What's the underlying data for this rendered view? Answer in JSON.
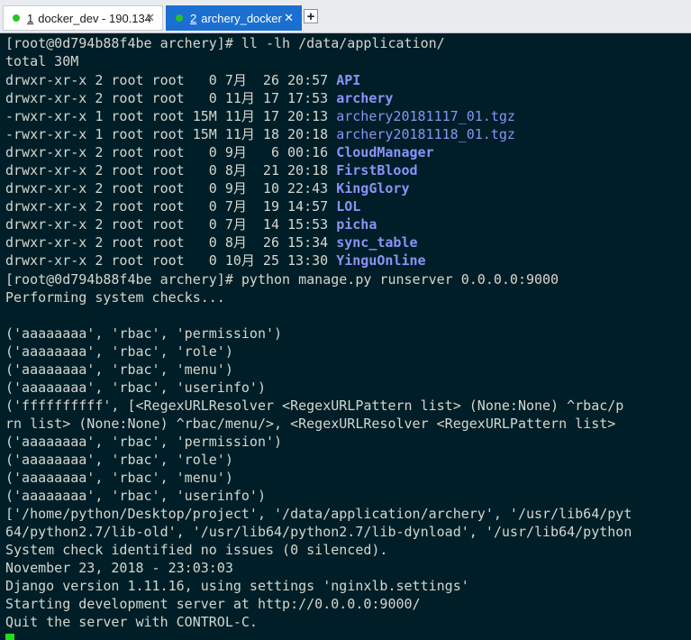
{
  "tabs": [
    {
      "num": "1",
      "label": "docker_dev - 190.134",
      "close": "✕"
    },
    {
      "num": "2",
      "label": "archery_docker",
      "close": "✕"
    }
  ],
  "add_tab_label": "+",
  "terminal": {
    "command1": "[root@0d794b88f4be archery]# ll -lh /data/application/",
    "total": "total 30M",
    "listing": [
      {
        "meta": "drwxr-xr-x 2 root root   0 7月  26 20:57 ",
        "name": "API"
      },
      {
        "meta": "drwxr-xr-x 2 root root   0 11月 17 17:53 ",
        "name": "archery"
      },
      {
        "meta": "-rwxr-xr-x 1 root root 15M 11月 17 20:13 ",
        "name": "archery20181117_01.tgz"
      },
      {
        "meta": "-rwxr-xr-x 1 root root 15M 11月 18 20:18 ",
        "name": "archery20181118_01.tgz"
      },
      {
        "meta": "drwxr-xr-x 2 root root   0 9月   6 00:16 ",
        "name": "CloudManager"
      },
      {
        "meta": "drwxr-xr-x 2 root root   0 8月  21 20:18 ",
        "name": "FirstBlood"
      },
      {
        "meta": "drwxr-xr-x 2 root root   0 9月  10 22:43 ",
        "name": "KingGlory"
      },
      {
        "meta": "drwxr-xr-x 2 root root   0 7月  19 14:57 ",
        "name": "LOL"
      },
      {
        "meta": "drwxr-xr-x 2 root root   0 7月  14 15:53 ",
        "name": "picha"
      },
      {
        "meta": "drwxr-xr-x 2 root root   0 8月  26 15:34 ",
        "name": "sync_table"
      },
      {
        "meta": "drwxr-xr-x 2 root root   0 10月 25 13:30 ",
        "name": "YinguOnline"
      }
    ],
    "output": [
      "[root@0d794b88f4be archery]# python manage.py runserver 0.0.0.0:9000",
      "Performing system checks...",
      "",
      "('aaaaaaaa', 'rbac', 'permission')",
      "('aaaaaaaa', 'rbac', 'role')",
      "('aaaaaaaa', 'rbac', 'menu')",
      "('aaaaaaaa', 'rbac', 'userinfo')",
      "('ffffffffff', [<RegexURLResolver <RegexURLPattern list> (None:None) ^rbac/p",
      "rn list> (None:None) ^rbac/menu/>, <RegexURLResolver <RegexURLPattern list> ",
      "('aaaaaaaa', 'rbac', 'permission')",
      "('aaaaaaaa', 'rbac', 'role')",
      "('aaaaaaaa', 'rbac', 'menu')",
      "('aaaaaaaa', 'rbac', 'userinfo')",
      "['/home/python/Desktop/project', '/data/application/archery', '/usr/lib64/pyt",
      "64/python2.7/lib-old', '/usr/lib64/python2.7/lib-dynload', '/usr/lib64/python",
      "System check identified no issues (0 silenced).",
      "November 23, 2018 - 23:03:03",
      "Django version 1.11.16, using settings 'nginxlb.settings'",
      "Starting development server at http://0.0.0.0:9000/",
      "Quit the server with CONTROL-C."
    ]
  },
  "colors": {
    "background": "#001e27",
    "text": "#d3d7cf",
    "dir": "#8a93f6",
    "active_tab": "#1b6fd0",
    "cursor": "#22dd22"
  }
}
